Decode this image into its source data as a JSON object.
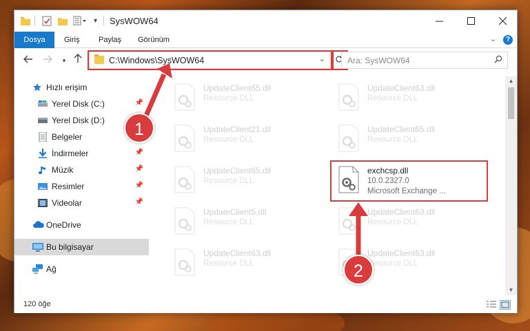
{
  "window": {
    "title": "SysWOW64"
  },
  "ribbon": {
    "tabs": [
      {
        "label": "Dosya",
        "active": true
      },
      {
        "label": "Giriş",
        "active": false
      },
      {
        "label": "Paylaş",
        "active": false
      },
      {
        "label": "Görünüm",
        "active": false
      }
    ],
    "help_label": "?"
  },
  "navigation": {
    "address_value": "C:\\Windows\\SysWOW64",
    "search_placeholder": "Ara: SysWOW64"
  },
  "sidebar": {
    "items": [
      {
        "label": "Hızlı erişim",
        "icon": "star-icon",
        "pinned": false
      },
      {
        "label": "Yerel Disk (C:)",
        "icon": "drive-icon",
        "pinned": true
      },
      {
        "label": "Yerel Disk (D:)",
        "icon": "drive-icon",
        "pinned": false
      },
      {
        "label": "Belgeler",
        "icon": "document-icon",
        "pinned": false
      },
      {
        "label": "İndirmeler",
        "icon": "download-icon",
        "pinned": true
      },
      {
        "label": "Müzik",
        "icon": "music-icon",
        "pinned": true
      },
      {
        "label": "Resimler",
        "icon": "pictures-icon",
        "pinned": true
      },
      {
        "label": "Videolar",
        "icon": "video-icon",
        "pinned": true
      },
      {
        "label": "OneDrive",
        "icon": "cloud-icon",
        "pinned": false
      },
      {
        "label": "Bu bilgisayar",
        "icon": "computer-icon",
        "pinned": false,
        "selected": true
      },
      {
        "label": "Ağ",
        "icon": "network-icon",
        "pinned": false
      }
    ]
  },
  "files": [
    {
      "name": "UpdateClient65.dll",
      "line2": "Resource DLL",
      "line3": "",
      "highlighted": false
    },
    {
      "name": "UpdateClient63.dll",
      "line2": "Resource DLL",
      "line3": "",
      "highlighted": false
    },
    {
      "name": "UpdateClient21.dll",
      "line2": "Resource DLL",
      "line3": "",
      "highlighted": false
    },
    {
      "name": "UpdateClient65.dll",
      "line2": "Resource DLL",
      "line3": "",
      "highlighted": false
    },
    {
      "name": "UpdateClient65.dll",
      "line2": "Resource DLL",
      "line3": "",
      "highlighted": false
    },
    {
      "name": "exchcsp.dll",
      "line2": "10.0.2327.0",
      "line3": "Microsoft Exchange ...",
      "highlighted": true
    },
    {
      "name": "UpdateClient5.dll",
      "line2": "Resource DLL",
      "line3": "",
      "highlighted": false
    },
    {
      "name": "UpdateClient63.dll",
      "line2": "Resource DLL",
      "line3": "",
      "highlighted": false
    },
    {
      "name": "UpdateClient63.dll",
      "line2": "Resource DLL",
      "line3": "",
      "highlighted": false
    },
    {
      "name": "UpdateClient63.dll",
      "line2": "Resource DLL",
      "line3": "",
      "highlighted": false
    }
  ],
  "status": {
    "item_count": "120 öğe"
  },
  "callouts": {
    "one": "1",
    "two": "2"
  },
  "colors": {
    "accent": "#1979ca",
    "highlight": "#d93c3c",
    "folder": "#f2c94c"
  }
}
